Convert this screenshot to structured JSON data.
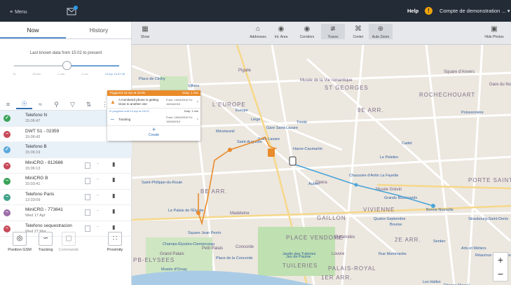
{
  "topbar": {
    "menu_label": "Menu",
    "help_label": "Help",
    "account_label": "Compte de demonstration ..."
  },
  "colors": {
    "topbar": "#232b36",
    "accent": "#2f6fb5",
    "route_orange": "#e98b2a",
    "route_blue": "#4aa5d8",
    "status_green": "#3aa35a",
    "status_red": "#c84a5a",
    "status_blue": "#5aa8dd",
    "status_teal": "#43a38a"
  },
  "sidebar": {
    "tabs": [
      "Now",
      "History"
    ],
    "last_known_text": "Last known data from 15:02 to present",
    "slider_ticks": [
      "1d",
      "30 min",
      "1 min",
      "1 min",
      "10 Apr 15:07:38"
    ],
    "slider_position": 0.5,
    "toolbar_icons": [
      "list-icon",
      "device-icon",
      "group-icon",
      "search-icon",
      "filter-icon",
      "sort-icon",
      "more-icon"
    ],
    "devices": [
      {
        "name": "Telefono N",
        "time": "15:06:47",
        "status": "check",
        "color": "#3aa35a",
        "selected": true
      },
      {
        "name": "DWT S1 - 02359",
        "time": "15:06:42",
        "status": "stop",
        "color": "#c84a5a",
        "selected": false
      },
      {
        "name": "Telefono B",
        "time": "15:06:19",
        "status": "check",
        "color": "#5aa8dd",
        "selected": true
      },
      {
        "name": "MiniCRG - 812686",
        "time": "15:06:13",
        "status": "stop",
        "color": "#c84a5a",
        "selected": false
      },
      {
        "name": "MiniCRG B",
        "time": "15:03:41",
        "status": "stop",
        "color": "#3aa35a",
        "selected": false
      },
      {
        "name": "Telefono Paris",
        "time": "13:33:09",
        "status": "stop",
        "color": "#43a38a",
        "selected": false
      },
      {
        "name": "MiniCRG - 773841",
        "time": "Wed 17 Apr",
        "status": "stop",
        "color": "#9c6ea8",
        "selected": false
      },
      {
        "name": "Telefono sequestracion",
        "time": "Wed 27 Mar",
        "status": "stop",
        "color": "#c84a5a",
        "selected": false
      }
    ],
    "actions": [
      {
        "label": "Position GSM",
        "icon": "target-icon"
      },
      {
        "label": "Tracking",
        "icon": "route-icon"
      },
      {
        "label": "Commande",
        "icon": "command-icon"
      },
      {
        "label": "Proximity",
        "icon": "proximity-icon"
      }
    ]
  },
  "map_tools": [
    {
      "label": "Show",
      "icon": "layers-icon"
    },
    {
      "label": "Addresses",
      "icon": "home-icon"
    },
    {
      "label": "Int. Area",
      "icon": "pin-icon"
    },
    {
      "label": "Corridors",
      "icon": "pin-icon"
    },
    {
      "label": "Traces",
      "icon": "trace-icon"
    },
    {
      "label": "Center",
      "icon": "center-icon"
    },
    {
      "label": "Auto Zoom",
      "icon": "zoom-icon"
    },
    {
      "label": "Hide Photos",
      "icon": "photo-icon"
    }
  ],
  "popup": {
    "header": "Triggered 19 Apr at 15:06",
    "header_right": "Duty: 1 min",
    "alert_text": "A monitored phone is getting close to another one",
    "alert_date": "From: 19/04/2019 To: 19/04/2019",
    "sub_header": "In progress until 19 Apr at 15:20",
    "sub_right": "Duty: 1 min",
    "tracking_text": "Tracking",
    "tracking_date": "From: 19/04/2019 To: 19/04/2019",
    "create_label": "Create"
  },
  "map_labels": {
    "districts": [
      "ST GEORGES",
      "ROCHECHOUART",
      "9E ARR.",
      "L'EUROPE",
      "BE ARR.",
      "VIVIENNE",
      "GAILLON",
      "2E ARR.",
      "PLACE VENDOME",
      "PB-ELYSEES",
      "TUILERIES",
      "PALAIS-ROYAL",
      "PORTE SAINT-DENIS",
      "1ER ARR."
    ],
    "places": [
      "Pigalle",
      "Musée de la Vie romantique",
      "Square d'Anvers",
      "Gare du Nord",
      "Musée Grévin",
      "Opéra",
      "Madeleine",
      "Concorde",
      "Grand Palais",
      "Petit Palais",
      "Louvre",
      "Pyramides",
      "Bourse",
      "Sentier",
      "Le Peletier",
      "Gare Saint-Lazare",
      "Saint-Lazare",
      "Havre-Caumartin",
      "Saint-Augustin",
      "Villiers",
      "Monceau",
      "Trinité",
      "Grands Boulevards",
      "Bonne Nouvelle",
      "Strasbourg-Saint-Denis",
      "Rue Montmartre",
      "Jardin des Tuileries",
      "Champs-Élysées-Clemenceau",
      "Square Jean Perrin",
      "Quatre-Septembre",
      "Miromesnil",
      "Saint-Philippe-du-Roule",
      "Le Palais de l'Élysée",
      "Place de la Concorde",
      "Jeu de Paume",
      "Musée d'Orsay",
      "Les Halles",
      "Réaumur-Sébastopol",
      "Cadet",
      "Poissonnière",
      "Chaussée d'Antin La Fayette",
      "Auber",
      "Étienne Marcel",
      "Arts et Métiers",
      "Parc Monceau",
      "Europe",
      "Liège",
      "Place de Clichy"
    ]
  }
}
